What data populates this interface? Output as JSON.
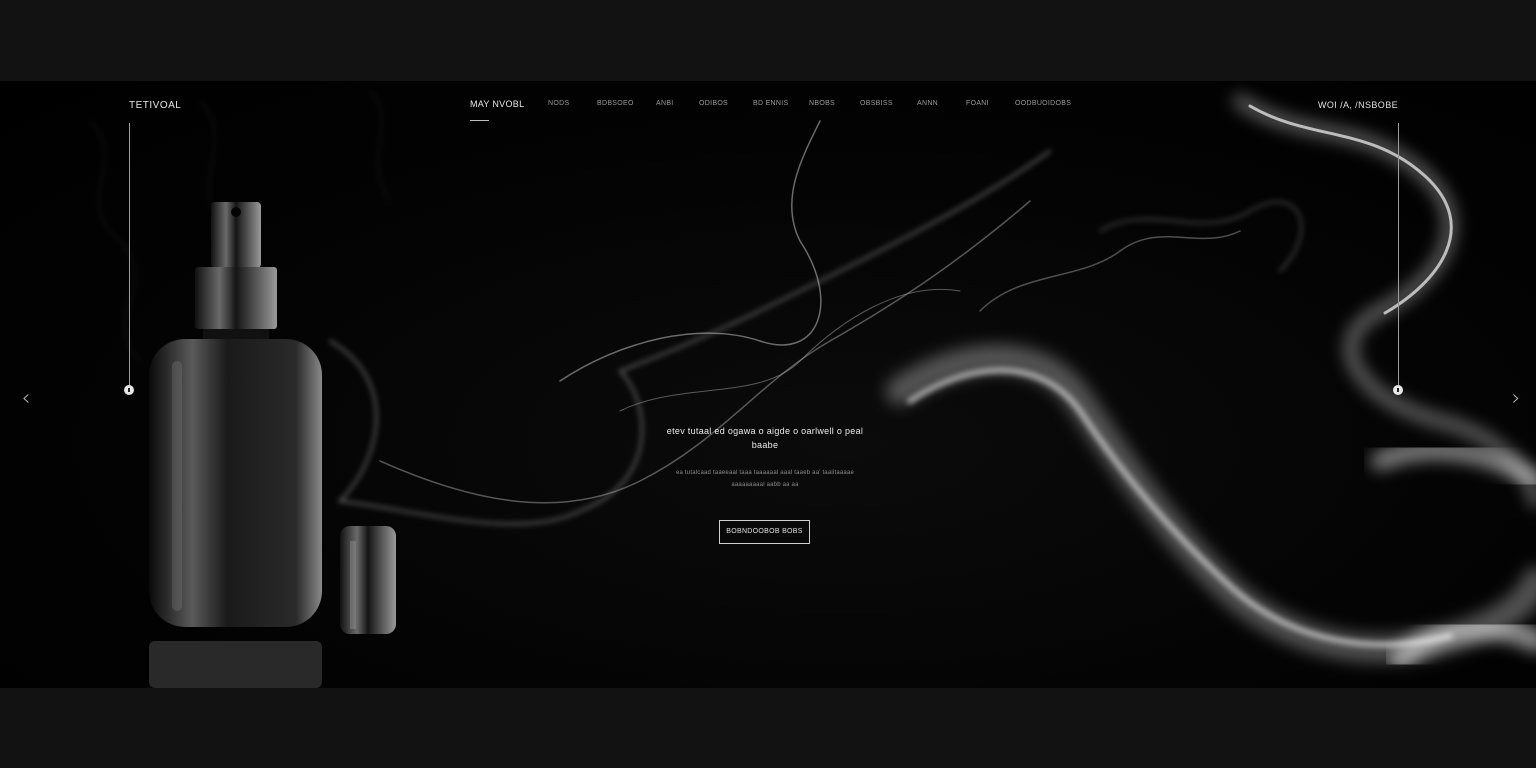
{
  "header": {
    "brand": "TETIVOAL",
    "right_label": "WOI /A, /NSBOBE"
  },
  "nav": {
    "items": [
      {
        "label": "MAY NVOBL",
        "active": true
      },
      {
        "label": "NODS"
      },
      {
        "label": "BDBSOEO"
      },
      {
        "label": "ANBI"
      },
      {
        "label": "ODIBOS"
      },
      {
        "label": "BD ENNIS"
      },
      {
        "label": "NBOBS"
      },
      {
        "label": "OBSBISS"
      },
      {
        "label": "ANNN"
      },
      {
        "label": "FOANI"
      },
      {
        "label": "OODBUOIDOBS"
      }
    ]
  },
  "hero": {
    "headline_line1": "etev tutaal ed ogawa o aigde o oarlwell o peal",
    "headline_line2": "baabe",
    "subtext_line1": "ea tutalcaad taaeeaal taaa taaaaaal aaal taaeb aa' taaiitaaaae",
    "subtext_line2": "aaaaaaaaal aabb aa aa",
    "cta_label": "BOBNDOOBOB BOBS"
  },
  "carousel": {
    "prev_icon": "chevron-left-icon",
    "next_icon": "chevron-right-icon",
    "prev_glyph": "‹",
    "next_glyph": "›"
  },
  "colors": {
    "page_bg": "#121212",
    "hero_bg": "#000000",
    "accent": "#e8e8e8"
  }
}
